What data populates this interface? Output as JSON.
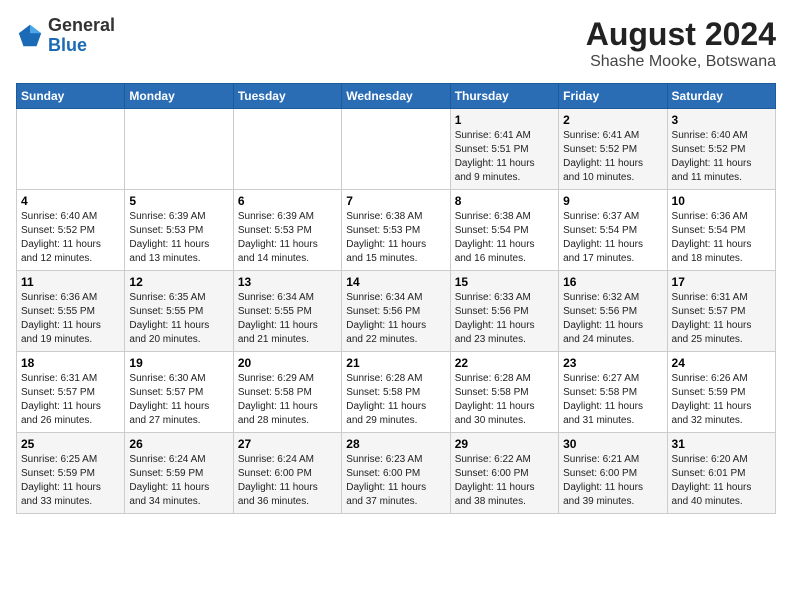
{
  "logo": {
    "general": "General",
    "blue": "Blue"
  },
  "title": "August 2024",
  "subtitle": "Shashe Mooke, Botswana",
  "days_of_week": [
    "Sunday",
    "Monday",
    "Tuesday",
    "Wednesday",
    "Thursday",
    "Friday",
    "Saturday"
  ],
  "weeks": [
    [
      {
        "day": "",
        "info": ""
      },
      {
        "day": "",
        "info": ""
      },
      {
        "day": "",
        "info": ""
      },
      {
        "day": "",
        "info": ""
      },
      {
        "day": "1",
        "info": "Sunrise: 6:41 AM\nSunset: 5:51 PM\nDaylight: 11 hours\nand 9 minutes."
      },
      {
        "day": "2",
        "info": "Sunrise: 6:41 AM\nSunset: 5:52 PM\nDaylight: 11 hours\nand 10 minutes."
      },
      {
        "day": "3",
        "info": "Sunrise: 6:40 AM\nSunset: 5:52 PM\nDaylight: 11 hours\nand 11 minutes."
      }
    ],
    [
      {
        "day": "4",
        "info": "Sunrise: 6:40 AM\nSunset: 5:52 PM\nDaylight: 11 hours\nand 12 minutes."
      },
      {
        "day": "5",
        "info": "Sunrise: 6:39 AM\nSunset: 5:53 PM\nDaylight: 11 hours\nand 13 minutes."
      },
      {
        "day": "6",
        "info": "Sunrise: 6:39 AM\nSunset: 5:53 PM\nDaylight: 11 hours\nand 14 minutes."
      },
      {
        "day": "7",
        "info": "Sunrise: 6:38 AM\nSunset: 5:53 PM\nDaylight: 11 hours\nand 15 minutes."
      },
      {
        "day": "8",
        "info": "Sunrise: 6:38 AM\nSunset: 5:54 PM\nDaylight: 11 hours\nand 16 minutes."
      },
      {
        "day": "9",
        "info": "Sunrise: 6:37 AM\nSunset: 5:54 PM\nDaylight: 11 hours\nand 17 minutes."
      },
      {
        "day": "10",
        "info": "Sunrise: 6:36 AM\nSunset: 5:54 PM\nDaylight: 11 hours\nand 18 minutes."
      }
    ],
    [
      {
        "day": "11",
        "info": "Sunrise: 6:36 AM\nSunset: 5:55 PM\nDaylight: 11 hours\nand 19 minutes."
      },
      {
        "day": "12",
        "info": "Sunrise: 6:35 AM\nSunset: 5:55 PM\nDaylight: 11 hours\nand 20 minutes."
      },
      {
        "day": "13",
        "info": "Sunrise: 6:34 AM\nSunset: 5:55 PM\nDaylight: 11 hours\nand 21 minutes."
      },
      {
        "day": "14",
        "info": "Sunrise: 6:34 AM\nSunset: 5:56 PM\nDaylight: 11 hours\nand 22 minutes."
      },
      {
        "day": "15",
        "info": "Sunrise: 6:33 AM\nSunset: 5:56 PM\nDaylight: 11 hours\nand 23 minutes."
      },
      {
        "day": "16",
        "info": "Sunrise: 6:32 AM\nSunset: 5:56 PM\nDaylight: 11 hours\nand 24 minutes."
      },
      {
        "day": "17",
        "info": "Sunrise: 6:31 AM\nSunset: 5:57 PM\nDaylight: 11 hours\nand 25 minutes."
      }
    ],
    [
      {
        "day": "18",
        "info": "Sunrise: 6:31 AM\nSunset: 5:57 PM\nDaylight: 11 hours\nand 26 minutes."
      },
      {
        "day": "19",
        "info": "Sunrise: 6:30 AM\nSunset: 5:57 PM\nDaylight: 11 hours\nand 27 minutes."
      },
      {
        "day": "20",
        "info": "Sunrise: 6:29 AM\nSunset: 5:58 PM\nDaylight: 11 hours\nand 28 minutes."
      },
      {
        "day": "21",
        "info": "Sunrise: 6:28 AM\nSunset: 5:58 PM\nDaylight: 11 hours\nand 29 minutes."
      },
      {
        "day": "22",
        "info": "Sunrise: 6:28 AM\nSunset: 5:58 PM\nDaylight: 11 hours\nand 30 minutes."
      },
      {
        "day": "23",
        "info": "Sunrise: 6:27 AM\nSunset: 5:58 PM\nDaylight: 11 hours\nand 31 minutes."
      },
      {
        "day": "24",
        "info": "Sunrise: 6:26 AM\nSunset: 5:59 PM\nDaylight: 11 hours\nand 32 minutes."
      }
    ],
    [
      {
        "day": "25",
        "info": "Sunrise: 6:25 AM\nSunset: 5:59 PM\nDaylight: 11 hours\nand 33 minutes."
      },
      {
        "day": "26",
        "info": "Sunrise: 6:24 AM\nSunset: 5:59 PM\nDaylight: 11 hours\nand 34 minutes."
      },
      {
        "day": "27",
        "info": "Sunrise: 6:24 AM\nSunset: 6:00 PM\nDaylight: 11 hours\nand 36 minutes."
      },
      {
        "day": "28",
        "info": "Sunrise: 6:23 AM\nSunset: 6:00 PM\nDaylight: 11 hours\nand 37 minutes."
      },
      {
        "day": "29",
        "info": "Sunrise: 6:22 AM\nSunset: 6:00 PM\nDaylight: 11 hours\nand 38 minutes."
      },
      {
        "day": "30",
        "info": "Sunrise: 6:21 AM\nSunset: 6:00 PM\nDaylight: 11 hours\nand 39 minutes."
      },
      {
        "day": "31",
        "info": "Sunrise: 6:20 AM\nSunset: 6:01 PM\nDaylight: 11 hours\nand 40 minutes."
      }
    ]
  ]
}
